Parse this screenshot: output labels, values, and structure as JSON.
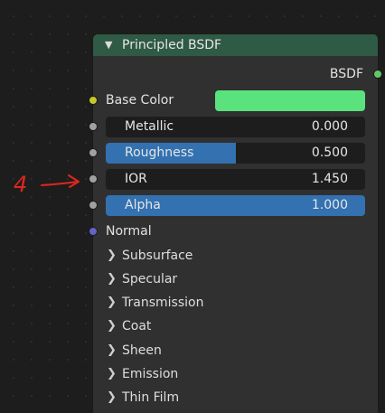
{
  "annotation": {
    "text": "4"
  },
  "node": {
    "title": "Principled BSDF",
    "output_socket": "BSDF",
    "colors": {
      "header": "#2f5a45",
      "body": "#303030",
      "slider_fill": "#3371b0",
      "socket_color": "#c7c729",
      "socket_float": "#a1a1a1",
      "socket_vector": "#6363c7",
      "socket_shader": "#63c763",
      "annotation": "#e0261d"
    },
    "inputs": {
      "base_color": {
        "label": "Base Color",
        "swatch": "#5ae27d"
      },
      "metallic": {
        "label": "Metallic",
        "value": "0.000",
        "fraction": 0.0
      },
      "roughness": {
        "label": "Roughness",
        "value": "0.500",
        "fraction": 0.5
      },
      "ior": {
        "label": "IOR",
        "value": "1.450",
        "fraction": 0.0
      },
      "alpha": {
        "label": "Alpha",
        "value": "1.000",
        "fraction": 1.0
      },
      "normal": {
        "label": "Normal"
      }
    },
    "panels": [
      {
        "label": "Subsurface"
      },
      {
        "label": "Specular"
      },
      {
        "label": "Transmission"
      },
      {
        "label": "Coat"
      },
      {
        "label": "Sheen"
      },
      {
        "label": "Emission"
      },
      {
        "label": "Thin Film"
      }
    ]
  }
}
